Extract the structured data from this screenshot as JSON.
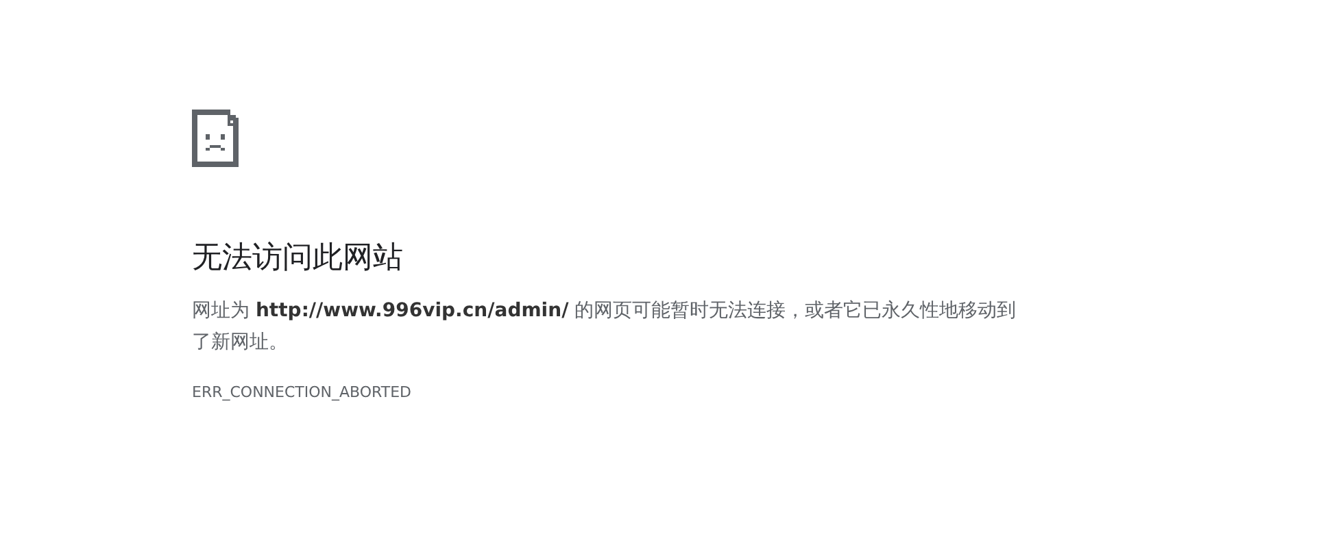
{
  "error_page": {
    "title": "无法访问此网站",
    "message": "网址为 **http://www.996vip.cn/admin/** 的网页可能暂时无法连接，或者它已永久性地移动到了新网址。",
    "error_code": "ERR_CONNECTION_ABORTED"
  }
}
